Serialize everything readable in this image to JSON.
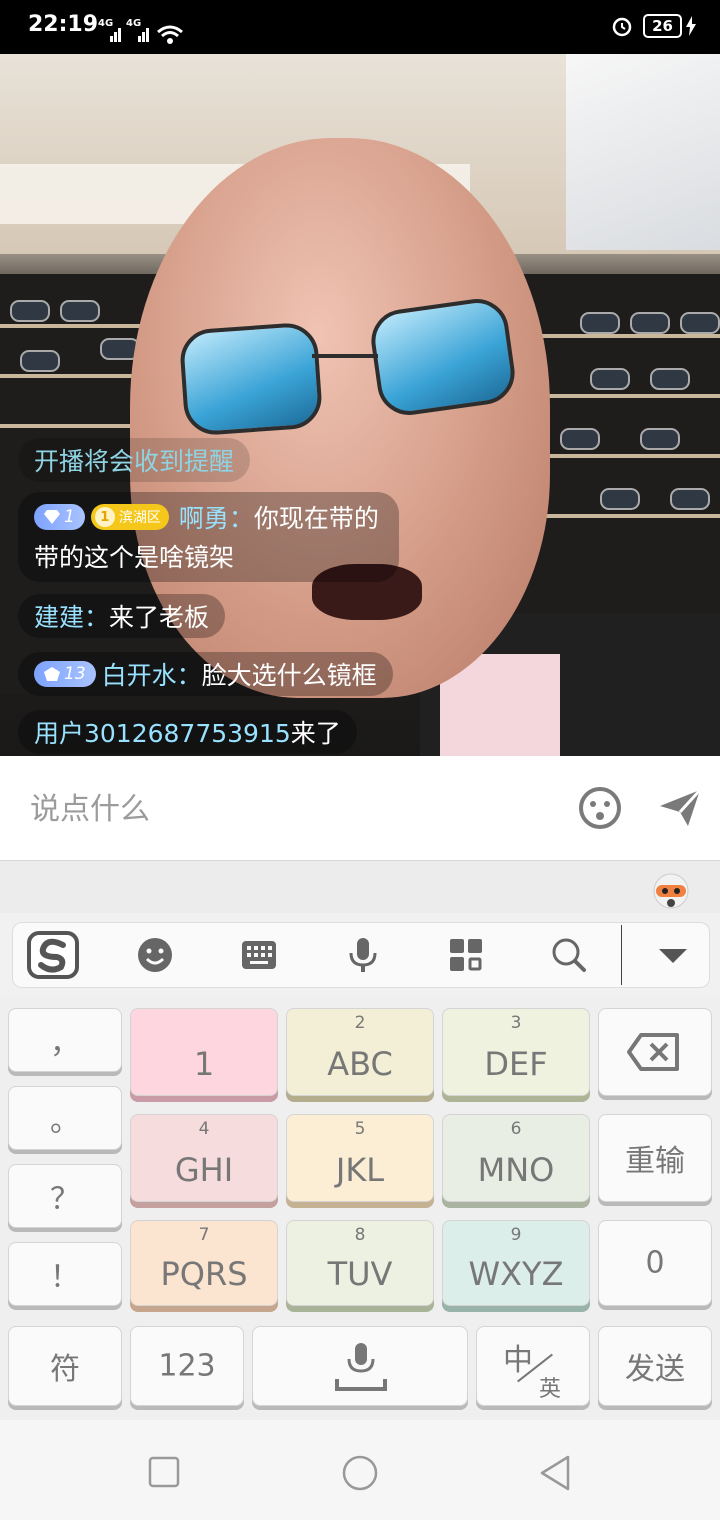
{
  "status_bar": {
    "time": "22:19",
    "signal1": "4G",
    "signal2": "4G",
    "battery": "26"
  },
  "chat": {
    "system_text": "开播将会收到提醒",
    "messages": [
      {
        "badge_level": "1",
        "region_badge": "滨湖区",
        "gold_badge_num": "1",
        "name": "啊勇：",
        "text_line1": "你现在带的",
        "text_line2": "带的这个是啥镜架"
      },
      {
        "name": "建建：",
        "text": "来了老板"
      },
      {
        "badge_level": "13",
        "name": "白开水：",
        "text": "脸大选什么镜框"
      },
      {
        "name": "用户3012687753915",
        "text": " 来了"
      }
    ]
  },
  "input": {
    "placeholder": "说点什么"
  },
  "keyboard": {
    "left_punct": [
      "，",
      "。",
      "？",
      "！"
    ],
    "keys": [
      {
        "num": "",
        "label": "1",
        "color": "#fdd6df",
        "edge": "#c99ba7"
      },
      {
        "num": "2",
        "label": "ABC",
        "color": "#f2efd6",
        "edge": "#b3ad8e"
      },
      {
        "num": "3",
        "label": "DEF",
        "color": "#eef2df",
        "edge": "#adb596"
      },
      {
        "num": "4",
        "label": "GHI",
        "color": "#f6dcdc",
        "edge": "#c4a19e"
      },
      {
        "num": "5",
        "label": "JKL",
        "color": "#fbeed5",
        "edge": "#c4b293"
      },
      {
        "num": "6",
        "label": "MNO",
        "color": "#e9eee4",
        "edge": "#a9b39f"
      },
      {
        "num": "7",
        "label": "PQRS",
        "color": "#fbe4d0",
        "edge": "#c5a68c"
      },
      {
        "num": "8",
        "label": "TUV",
        "color": "#ecf1e1",
        "edge": "#a8b398"
      },
      {
        "num": "9",
        "label": "WXYZ",
        "color": "#dceee9",
        "edge": "#98b3aa"
      }
    ],
    "reinput": "重输",
    "zero": "0",
    "symbol": "符",
    "num_switch": "123",
    "lang_zh": "中",
    "lang_en": "英",
    "send": "发送"
  },
  "icons": {
    "emoji": "emoji-icon",
    "send": "send-arrow-icon",
    "sogou": "sogou-logo-icon",
    "keyboard": "keyboard-icon",
    "mic": "mic-icon",
    "apps": "apps-grid-icon",
    "search": "search-icon",
    "collapse": "collapse-triangle-icon",
    "backspace": "backspace-icon"
  }
}
